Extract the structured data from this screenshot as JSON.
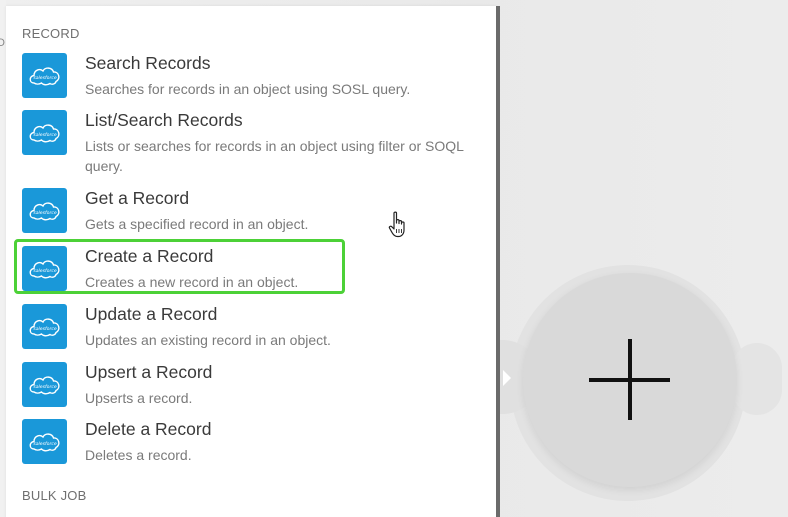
{
  "left_strip": {
    "text": "D"
  },
  "sections": {
    "record": {
      "title": "RECORD"
    },
    "bulk_job": {
      "title": "BULK JOB"
    }
  },
  "items": [
    {
      "title": "Search Records",
      "desc": "Searches for records in an object using SOSL query."
    },
    {
      "title": "List/Search Records",
      "desc": "Lists or searches for records in an object using filter or SOQL query."
    },
    {
      "title": "Get a Record",
      "desc": "Gets a specified record in an object."
    },
    {
      "title": "Create a Record",
      "desc": "Creates a new record in an object."
    },
    {
      "title": "Update a Record",
      "desc": "Updates an existing record in an object."
    },
    {
      "title": "Upsert a Record",
      "desc": "Upserts a record."
    },
    {
      "title": "Delete a Record",
      "desc": "Deletes a record."
    }
  ],
  "logo": {
    "text": "salesforce",
    "color": "#1a98d9",
    "icon": "salesforce-cloud-icon"
  },
  "highlight_color": "#4cd137",
  "add_button": {
    "icon": "plus-icon"
  }
}
